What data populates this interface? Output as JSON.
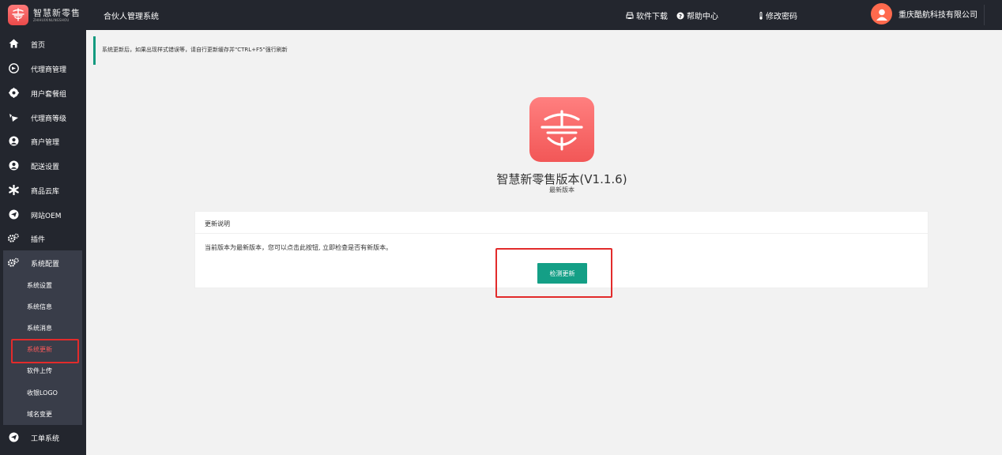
{
  "header": {
    "brand_cn": "智慧新零售",
    "brand_en": "ZHIHUIXINLINGSHOU",
    "system_title": "合伙人管理系统",
    "download_label": "软件下载",
    "help_label": "帮助中心",
    "password_label": "修改密码",
    "company_name": "重庆酷航科技有限公司"
  },
  "sidebar": {
    "items": [
      {
        "label": "首页",
        "icon": "home-icon"
      },
      {
        "label": "代理商管理",
        "icon": "agent-icon"
      },
      {
        "label": "用户套餐组",
        "icon": "package-icon"
      },
      {
        "label": "代理商等级",
        "icon": "level-icon"
      },
      {
        "label": "商户管理",
        "icon": "merchant-icon"
      },
      {
        "label": "配送设置",
        "icon": "delivery-icon"
      },
      {
        "label": "商品云库",
        "icon": "cloud-icon"
      },
      {
        "label": "网站OEM",
        "icon": "send-icon"
      },
      {
        "label": "插件",
        "icon": "plugin-icon"
      },
      {
        "label": "系统配置",
        "icon": "settings-icon"
      }
    ],
    "sub_items": [
      {
        "label": "系统设置"
      },
      {
        "label": "系统信息"
      },
      {
        "label": "系统消息"
      },
      {
        "label": "系统更新"
      },
      {
        "label": "软件上传"
      },
      {
        "label": "收银LOGO"
      },
      {
        "label": "域名变更"
      }
    ],
    "bottom_item": {
      "label": "工单系统",
      "icon": "send-icon"
    }
  },
  "main": {
    "notice": "系统更新后，如果出现样式错误等，请自行更新缓存并\"CTRL+F5\"强行刷新",
    "version_title": "智慧新零售版本(V1.1.6)",
    "version_status": "最新版本",
    "card_title": "更新说明",
    "card_text": "当前版本为最新版本，您可以点击此按钮, 立即检查是否有新版本。",
    "check_button": "检测更新"
  },
  "colors": {
    "sidebar_bg": "#23262e",
    "accent_green": "#149f86",
    "highlight_red": "#e22b2b",
    "brand_red": "#f25757"
  }
}
